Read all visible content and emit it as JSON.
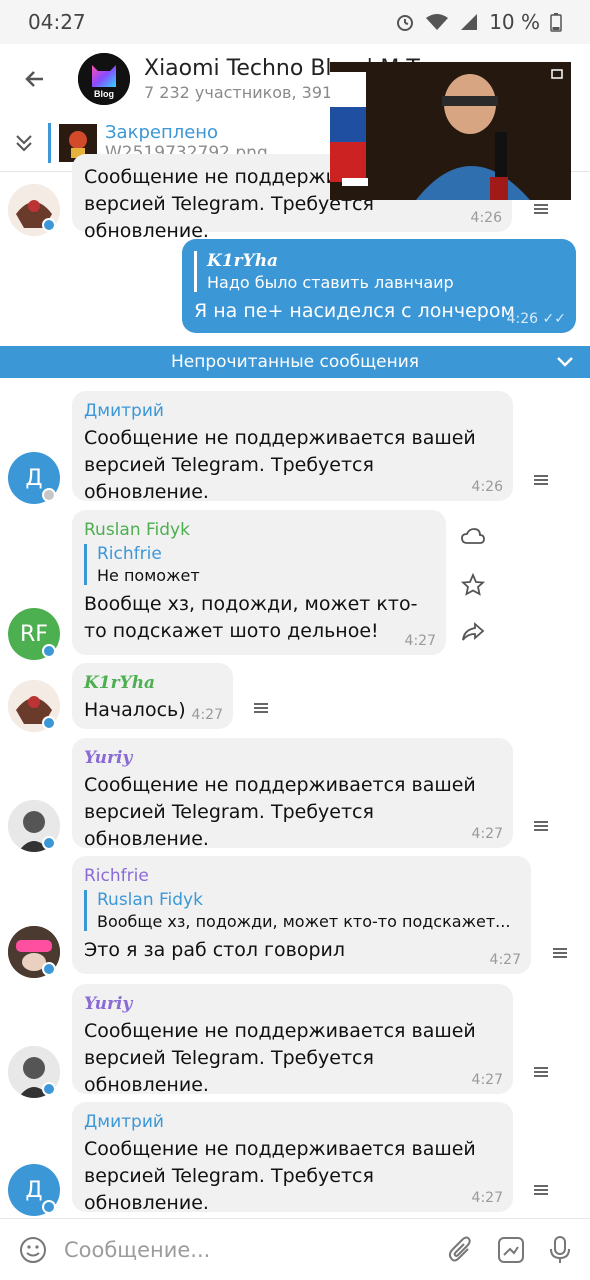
{
  "status_bar": {
    "time": "04:27",
    "battery": "10 %"
  },
  "header": {
    "title": "Xiaomi Techno Blog | M.T",
    "subtitle": "7 232 участников, 391",
    "avatar_text": "Blog"
  },
  "pinned": {
    "label": "Закреплено",
    "file": "W2519732792.png"
  },
  "messages": {
    "m0": {
      "text": "Сообщение не поддерживается вашей версией Telegram. Требуется обновление.",
      "time": "4:26"
    },
    "m1": {
      "reply_name": "K1rYha",
      "reply_text": "Надо было ставить лавнчаир",
      "text": "Я на пе+ насиделся с лончером",
      "time": "4:26"
    },
    "unread_label": "Непрочитанные сообщения",
    "m2": {
      "sender": "Дмитрий",
      "avatar_letter": "Д",
      "text": "Сообщение не поддерживается вашей версией Telegram. Требуется обновление.",
      "time": "4:26"
    },
    "m3": {
      "sender": "Ruslan Fidyk",
      "avatar_letter": "RF",
      "reply_name": "Richfrie",
      "reply_text": "Не поможет",
      "text": "Вообще хз, подожди, может кто-то подскажет шото дельное!",
      "time": "4:27"
    },
    "m4": {
      "sender": "K1rYha",
      "text": "Началось)",
      "time": "4:27"
    },
    "m5": {
      "sender": "Yuriy",
      "text": "Сообщение не поддерживается вашей версией Telegram. Требуется обновление.",
      "time": "4:27"
    },
    "m6": {
      "sender": "Richfrie",
      "reply_name": "Ruslan Fidyk",
      "reply_text": "Вообще хз, подожди, может кто-то подскажет...",
      "text": "Это я за раб стол говорил",
      "time": "4:27"
    },
    "m7": {
      "sender": "Yuriy",
      "text": "Сообщение не поддерживается вашей версией Telegram. Требуется обновление.",
      "time": "4:27"
    },
    "m8": {
      "sender": "Дмитрий",
      "avatar_letter": "Д",
      "text": "Сообщение не поддерживается вашей версией Telegram. Требуется обновление.",
      "time": "4:27"
    }
  },
  "input": {
    "placeholder": "Сообщение..."
  },
  "colors": {
    "accent": "#3c97d6",
    "ruslan": "#4caf50",
    "richfrie": "#8a6bd6",
    "kiryha": "#4caf50",
    "yuriy": "#8a6bd6"
  }
}
